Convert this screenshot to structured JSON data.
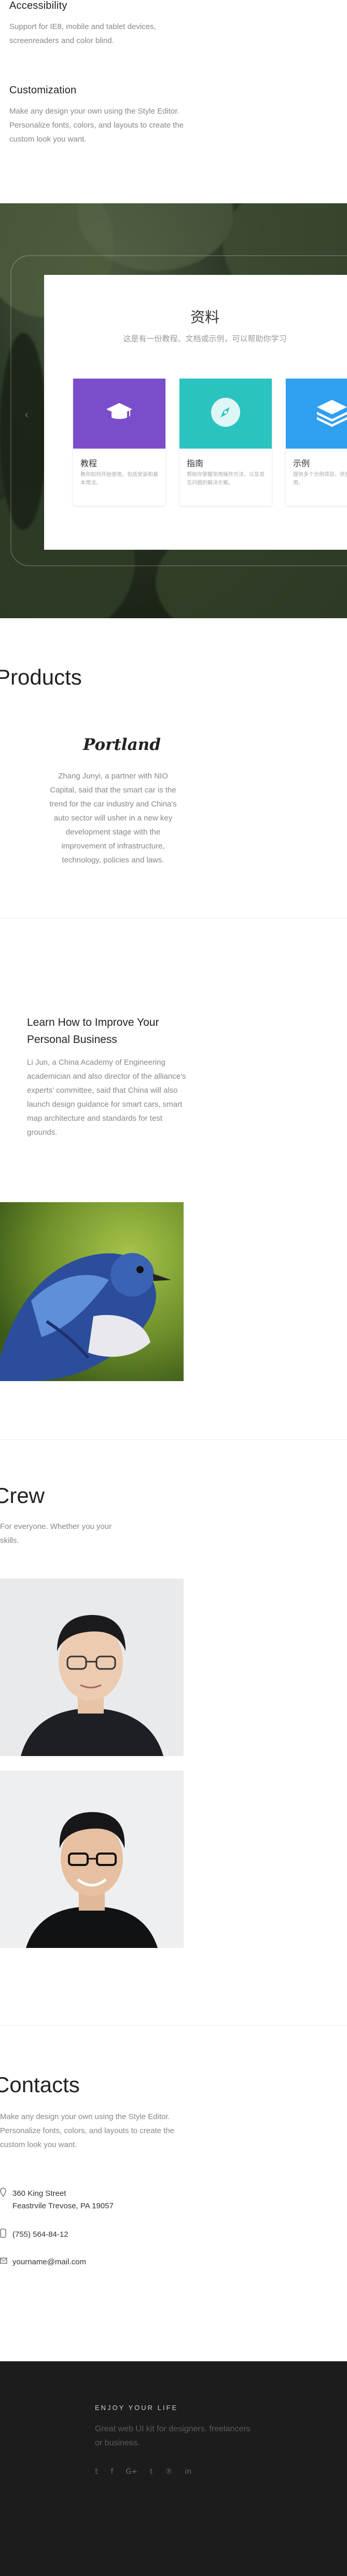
{
  "features": [
    {
      "title": "Accessibility",
      "text": "Support for IE8, mobile and tablet devices, screenreaders and color blind."
    },
    {
      "title": "Customization",
      "text": "Make any design your own using the Style Editor. Personalize fonts, colors, and layouts to create the custom look you want."
    }
  ],
  "resources": {
    "title": "资料",
    "subtitle": "这是有一份教程、文档或示例，可以帮助你学习",
    "tiles": [
      {
        "title": "教程",
        "text": "教你如何开始使用，包括安装和基本用法。",
        "icon": "graduation-cap-icon",
        "color": "#7c4dcb"
      },
      {
        "title": "指南",
        "text": "帮助你掌握常用操作方法，以及常见问题的解决方案。",
        "icon": "compass-icon",
        "color": "#2ac3c0"
      },
      {
        "title": "示例",
        "text": "提供多个示例项目，供参考学习使用。",
        "icon": "layers-icon",
        "color": "#2f9ff0"
      }
    ]
  },
  "products": {
    "title": "Products",
    "logo_text": "Portland",
    "text": "Zhang Junyi, a partner with NIO Capital, said that the smart car is the trend for the car industry and China's auto sector will usher in a new key development stage with the improvement of infrastructure, technology, policies and laws."
  },
  "article": {
    "title": "Learn How to Improve Your Personal Business",
    "text": "Li Jun, a China Academy of Engineering academician and also director of the alliance's experts' committee, said that China will also launch design guidance for smart cars, smart map architecture and standards for test grounds."
  },
  "crew": {
    "title": "Crew",
    "text": "For everyone. Whether you your skills."
  },
  "contacts": {
    "title": "Contacts",
    "text": "Make any design your own using the Style Editor. Personalize fonts, colors, and layouts to create the custom look you want.",
    "address_line1": "360 King Street",
    "address_line2": "Feastrvile Trevose, PA 19057",
    "phone": "(755) 564-84-12",
    "email": "yourname@mail.com"
  },
  "footer": {
    "heading": "ENJOY YOUR LIFE",
    "text": "Great web UI kit for designers, freelancers or business.",
    "social": [
      "twitter-icon",
      "facebook-icon",
      "google-plus-icon",
      "tumblr-icon",
      "pinterest-icon",
      "linkedin-icon"
    ]
  }
}
